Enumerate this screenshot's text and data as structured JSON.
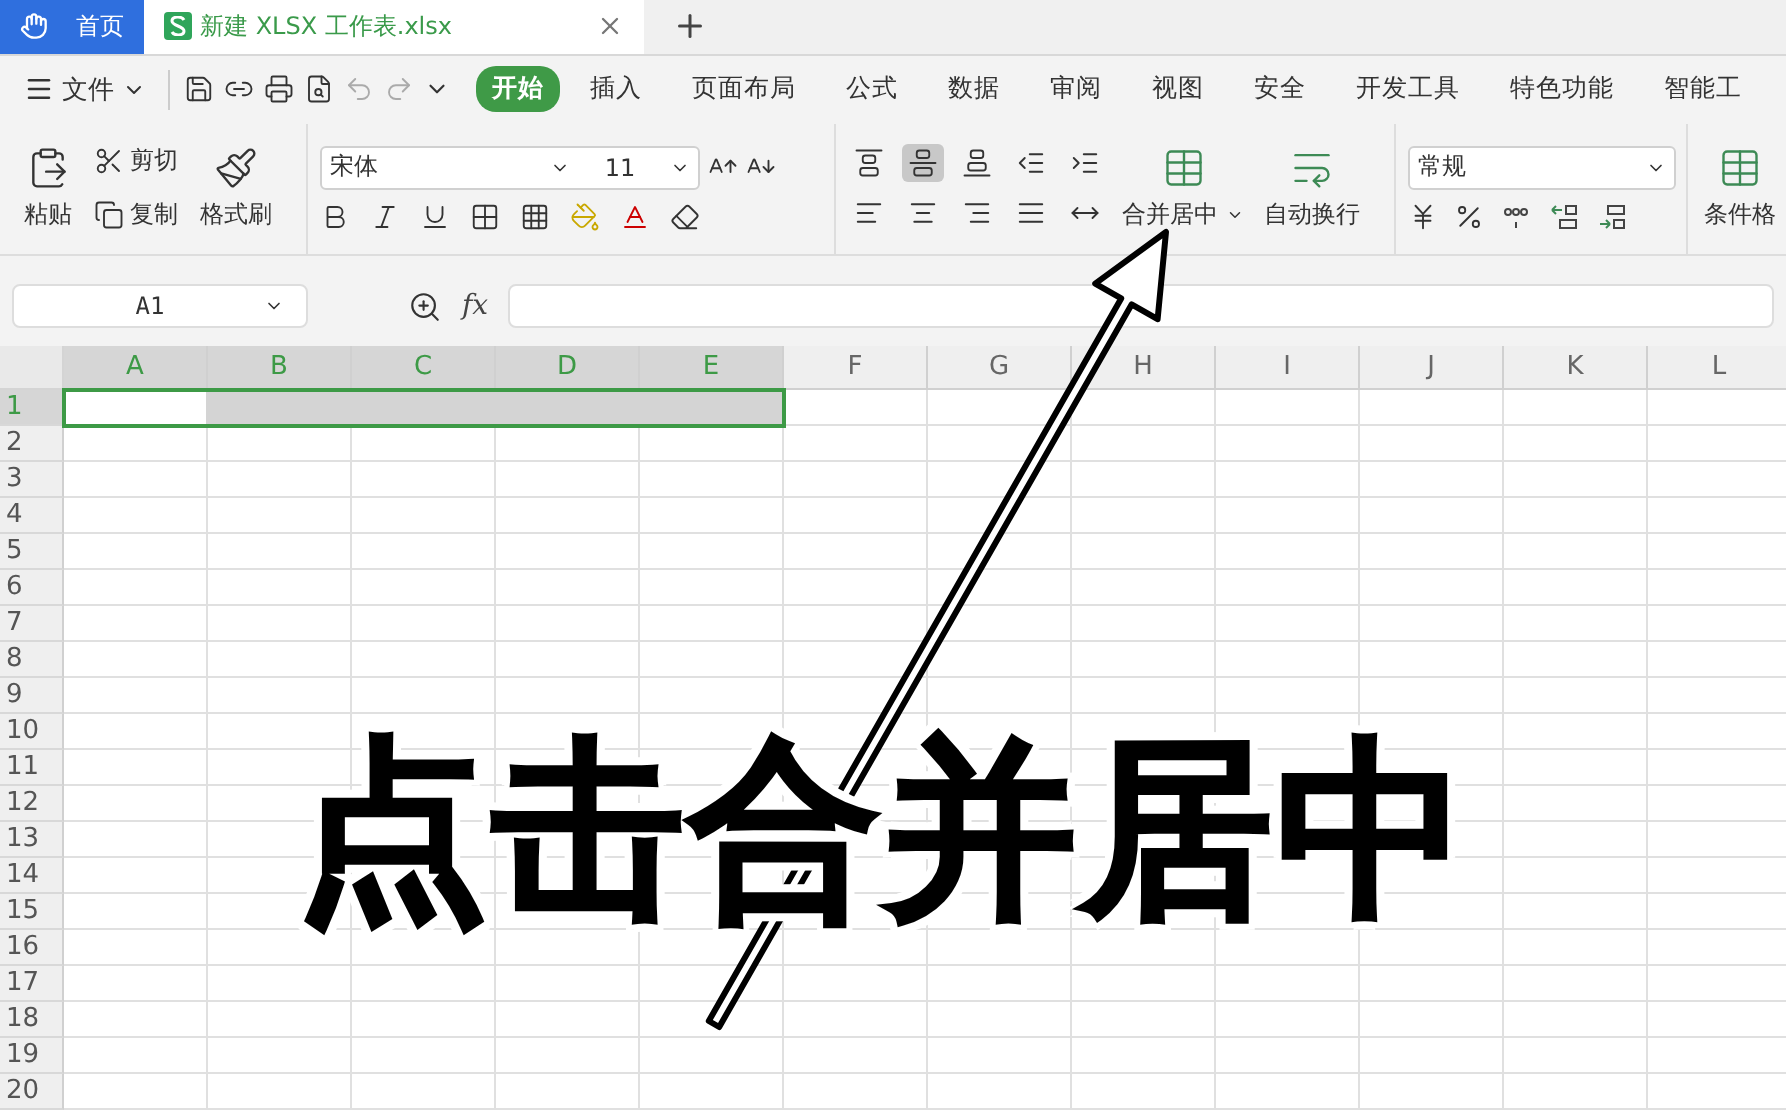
{
  "tabs": [
    {
      "label": "首页",
      "kind": "home",
      "selected": false
    },
    {
      "label": "新建 XLSX 工作表.xlsx",
      "kind": "document",
      "selected": true
    }
  ],
  "menu": {
    "file": "文件",
    "items": [
      {
        "label": "开始",
        "selected": true
      },
      {
        "label": "插入",
        "selected": false
      },
      {
        "label": "页面布局",
        "selected": false
      },
      {
        "label": "公式",
        "selected": false
      },
      {
        "label": "数据",
        "selected": false
      },
      {
        "label": "审阅",
        "selected": false
      },
      {
        "label": "视图",
        "selected": false
      },
      {
        "label": "安全",
        "selected": false
      },
      {
        "label": "开发工具",
        "selected": false
      },
      {
        "label": "特色功能",
        "selected": false
      },
      {
        "label": "智能工",
        "selected": false
      }
    ]
  },
  "ribbon": {
    "paste": "粘贴",
    "cut": "剪切",
    "copy": "复制",
    "format_painter": "格式刷",
    "font_name": "宋体",
    "font_size": "11",
    "merge_center": "合并居中",
    "wrap_text": "自动换行",
    "number_format": "常规",
    "conditional_format": "条件格",
    "align_center_selected": true
  },
  "formula_bar": {
    "name_box": "A1",
    "fx": "fx"
  },
  "grid": {
    "columns": [
      {
        "label": "A",
        "selected": true
      },
      {
        "label": "B",
        "selected": true
      },
      {
        "label": "C",
        "selected": true
      },
      {
        "label": "D",
        "selected": true
      },
      {
        "label": "E",
        "selected": true
      },
      {
        "label": "F",
        "selected": false
      },
      {
        "label": "G",
        "selected": false
      },
      {
        "label": "H",
        "selected": false
      },
      {
        "label": "I",
        "selected": false
      },
      {
        "label": "J",
        "selected": false
      },
      {
        "label": "K",
        "selected": false
      },
      {
        "label": "L",
        "selected": false
      }
    ],
    "rows": [
      {
        "label": "1",
        "selected": true
      },
      {
        "label": "2",
        "selected": false
      },
      {
        "label": "3",
        "selected": false
      },
      {
        "label": "4",
        "selected": false
      },
      {
        "label": "5",
        "selected": false
      },
      {
        "label": "6",
        "selected": false
      },
      {
        "label": "7",
        "selected": false
      },
      {
        "label": "8",
        "selected": false
      },
      {
        "label": "9",
        "selected": false
      },
      {
        "label": "10",
        "selected": false
      },
      {
        "label": "11",
        "selected": false
      },
      {
        "label": "12",
        "selected": false
      },
      {
        "label": "13",
        "selected": false
      },
      {
        "label": "14",
        "selected": false
      },
      {
        "label": "15",
        "selected": false
      },
      {
        "label": "16",
        "selected": false
      },
      {
        "label": "17",
        "selected": false
      },
      {
        "label": "18",
        "selected": false
      },
      {
        "label": "19",
        "selected": false
      },
      {
        "label": "20",
        "selected": false
      }
    ]
  },
  "annotation": {
    "text": "点击合并居中"
  }
}
